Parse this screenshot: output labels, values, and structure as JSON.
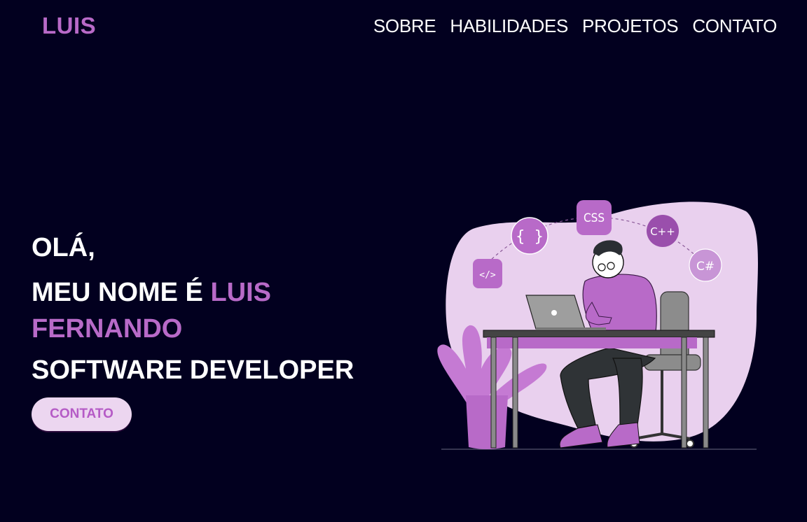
{
  "brand": {
    "logo_text": "LUIS"
  },
  "nav": {
    "items": [
      {
        "label": "SOBRE"
      },
      {
        "label": "HABILIDADES"
      },
      {
        "label": "PROJETOS"
      },
      {
        "label": "CONTATO"
      }
    ]
  },
  "hero": {
    "greeting": "OLÁ,",
    "name_prefix": "MEU NOME É ",
    "name_highlight_1": "LUIS",
    "name_highlight_2": "FERNANDO",
    "role": "SOFTWARE DEVELOPER",
    "cta_label": "CONTATO"
  },
  "illustration": {
    "badges": [
      "</>",
      "{ }",
      "CSS",
      "C++",
      "C#"
    ]
  },
  "colors": {
    "background": "#02001f",
    "accent": "#b86ac8",
    "button_bg": "#ecd6f0",
    "blob": "#e9d0ee"
  }
}
